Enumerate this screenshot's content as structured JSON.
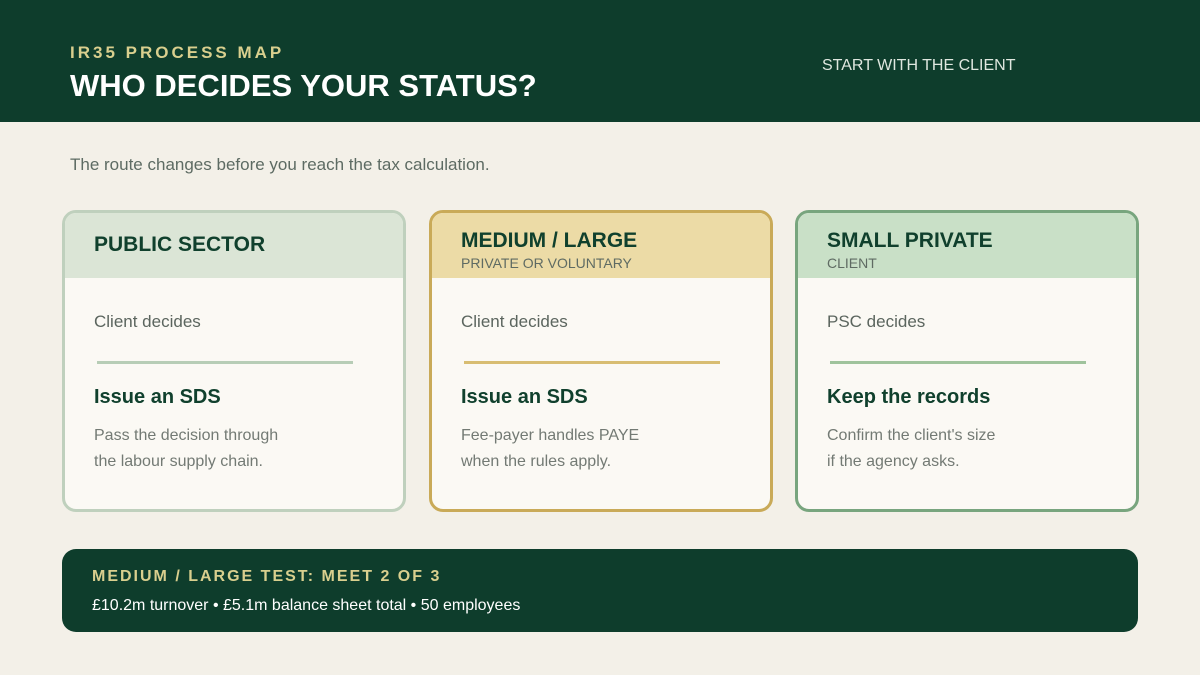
{
  "header": {
    "eyebrow": "IR35 PROCESS MAP",
    "title": "WHO DECIDES YOUR STATUS?",
    "note": "START WITH THE CLIENT"
  },
  "intro": "The route changes before you reach the tax calculation.",
  "cards": [
    {
      "title": "PUBLIC SECTOR",
      "subtitle": "",
      "decider": "Client decides",
      "action": "Issue an SDS",
      "desc_lines": [
        "Pass the decision through",
        "the labour supply chain."
      ],
      "colors": {
        "border": "#bfd0bd",
        "head": "#dbe5d6",
        "rule": "#b7cdb6"
      }
    },
    {
      "title": "MEDIUM / LARGE",
      "subtitle": "PRIVATE OR VOLUNTARY",
      "decider": "Client decides",
      "action": "Issue an SDS",
      "desc_lines": [
        "Fee-payer handles PAYE",
        "when the rules apply."
      ],
      "colors": {
        "border": "#c9aa58",
        "head": "#ecdba6",
        "rule": "#d8bd72"
      }
    },
    {
      "title": "SMALL PRIVATE",
      "subtitle": "CLIENT",
      "decider": "PSC decides",
      "action": "Keep the records",
      "desc_lines": [
        "Confirm the client's size",
        "if the agency asks."
      ],
      "colors": {
        "border": "#78a57e",
        "head": "#c9e0c7",
        "rule": "#9fc39c"
      }
    }
  ],
  "footer": {
    "title": "MEDIUM / LARGE TEST: MEET 2 OF 3",
    "text": "£10.2m turnover • £5.1m balance sheet total • 50 employees"
  }
}
